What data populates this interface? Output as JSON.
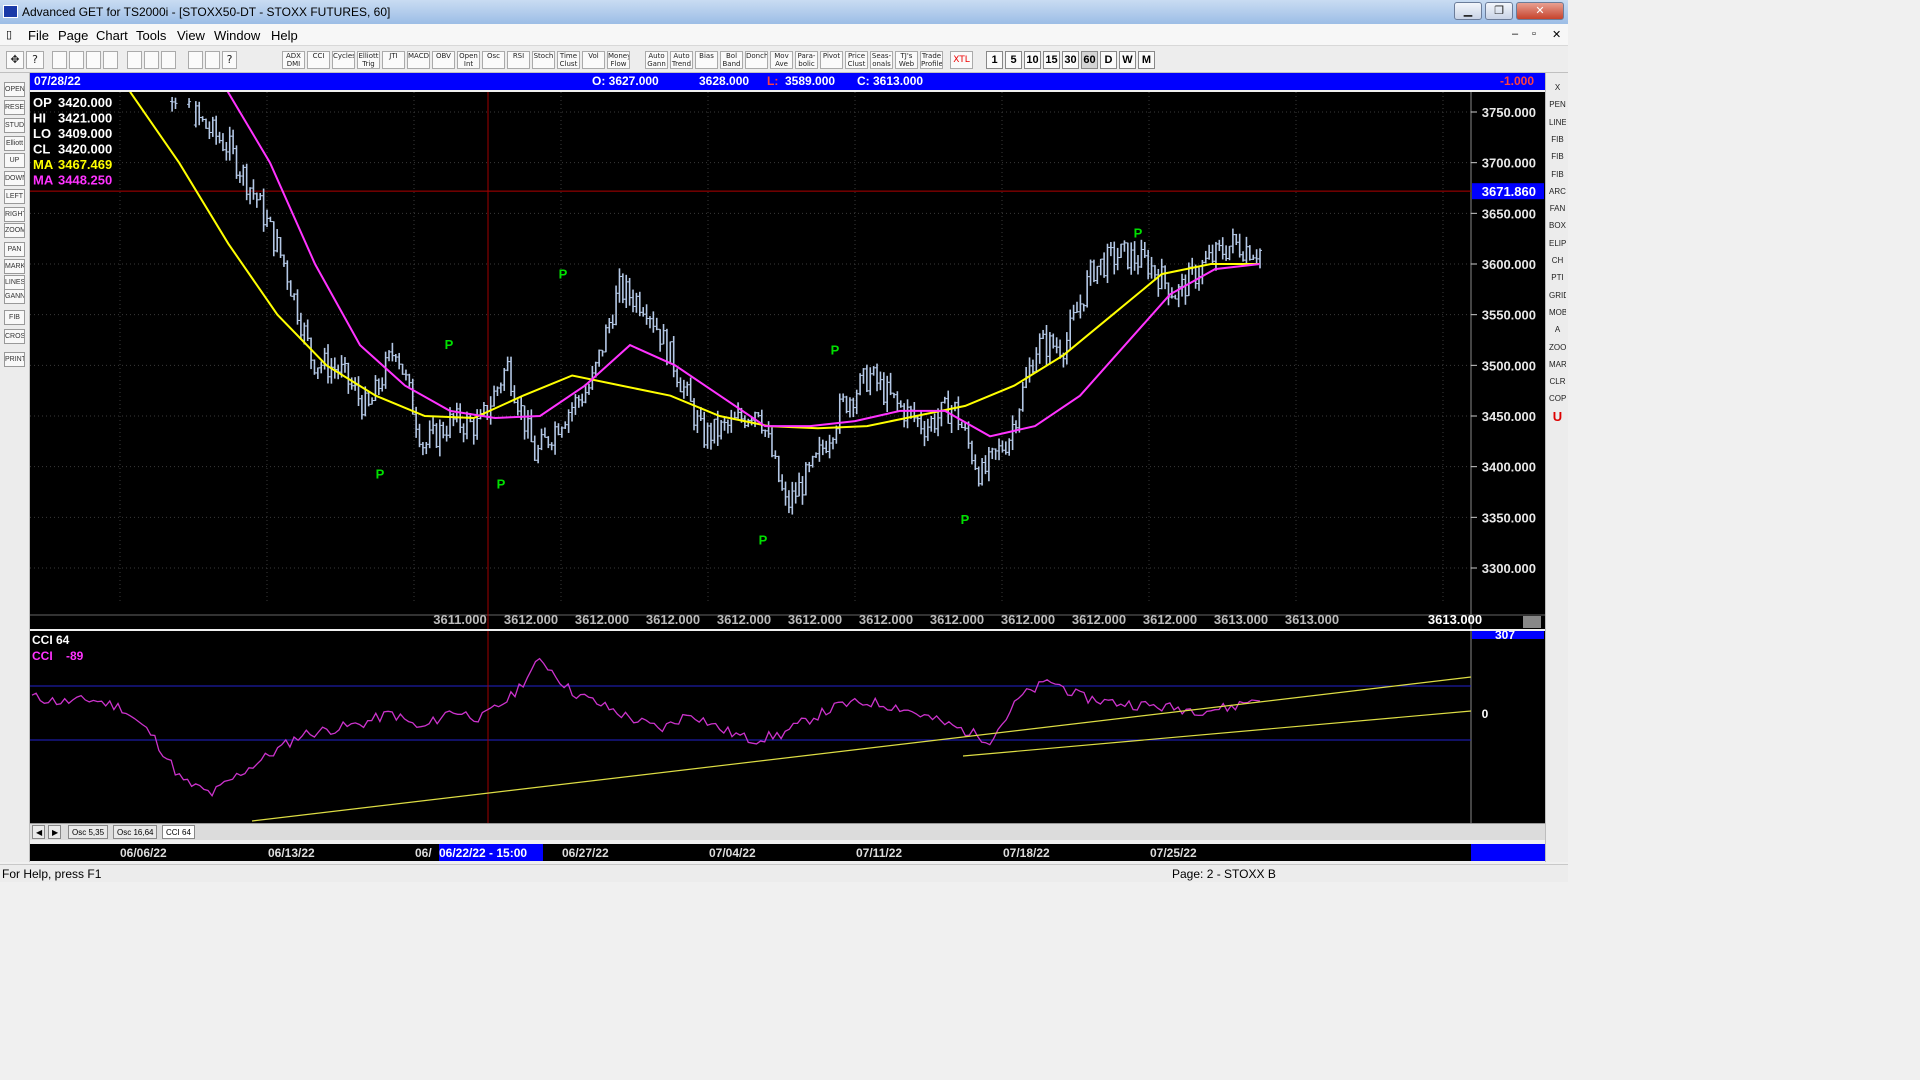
{
  "window": {
    "title": "Advanced GET for TS2000i - [STOXX50-DT - STOXX FUTURES, 60]",
    "min": "▁",
    "max": "❐",
    "close": "✕"
  },
  "mdi": {
    "min": "–",
    "restore": "▫",
    "close": "✕"
  },
  "menu": [
    "File",
    "Page",
    "Chart",
    "Tools",
    "View",
    "Window",
    "Help"
  ],
  "toolbar": {
    "study_buttons": [
      "ADX DMI",
      "CCI",
      "Cycles",
      "Elliott Trig",
      "JTI",
      "MACD",
      "OBV",
      "Open Int",
      "Osc",
      "RSI",
      "Stoch",
      "Time Clust",
      "Vol",
      "Money Flow",
      "Auto Gann",
      "Auto Trend",
      "Bias",
      "Bol Band",
      "Donch",
      "Mov Ave",
      "Para-bolic",
      "Pivot",
      "Price Clust",
      "Seas-onals",
      "TJ's Web",
      "Trade Profile",
      "XTL"
    ],
    "timeframes": [
      "1",
      "5",
      "10",
      "15",
      "30",
      "60",
      "D",
      "W",
      "M"
    ],
    "active_timeframe": "60"
  },
  "left_tools": [
    "OPEN",
    "RESET",
    "STUDY",
    "Elliott",
    "UP",
    "DOWN",
    "LEFT",
    "RIGHT",
    "ZOOM",
    "PAN",
    "MARK",
    "LINES",
    "GANN",
    "FIB",
    "CROSS",
    "PRINT"
  ],
  "right_tools": [
    "X",
    "PEN",
    "LINE",
    "FIB RET",
    "FIB EXT",
    "FIB TIME",
    "ARC",
    "FAN",
    "BOX",
    "ELIPS",
    "CH",
    "PTI",
    "GRID",
    "MOB",
    "A",
    "ZOOM",
    "MARK",
    "CLR",
    "COPY",
    "U"
  ],
  "info": {
    "date": "07/28/22",
    "open": "O: 3627.000",
    "high": "3628.000",
    "low_label": "L:",
    "low": "3589.000",
    "close": "C: 3613.000",
    "change": "-1.000"
  },
  "legend": [
    {
      "label": "OP",
      "value": "3420.000",
      "color": "#ffffff"
    },
    {
      "label": "HI",
      "value": "3421.000",
      "color": "#ffffff"
    },
    {
      "label": "LO",
      "value": "3409.000",
      "color": "#ffffff"
    },
    {
      "label": "CL",
      "value": "3420.000",
      "color": "#ffffff"
    },
    {
      "label": "MA",
      "value": "3467.469",
      "color": "#ffff00"
    },
    {
      "label": "MA",
      "value": "3448.250",
      "color": "#ff33ff"
    }
  ],
  "price_axis": {
    "ticks": [
      "3750.000",
      "3700.000",
      "3650.000",
      "3600.000",
      "3550.000",
      "3500.000",
      "3450.000",
      "3400.000",
      "3350.000",
      "3300.000"
    ],
    "marker": "3671.860"
  },
  "bottom_value_row": [
    "3611.000",
    "3612.000",
    "3612.000",
    "3612.000",
    "3612.000",
    "3612.000",
    "3612.000",
    "3612.000",
    "3612.000",
    "3612.000",
    "3612.000",
    "3613.000",
    "3613.000",
    "3613.000"
  ],
  "pivot_label": "P",
  "osc": {
    "title": "CCI 64",
    "sub_label": "CCI",
    "sub_value": "-89",
    "top_value": "307",
    "zero_value": "0"
  },
  "osc_tabs": [
    "Osc 5,35",
    "Osc 16,64",
    "CCI 64"
  ],
  "dates": [
    "06/06/22",
    "06/13/22",
    "06/",
    "06/22/22 - 15:00",
    "06/27/22",
    "07/04/22",
    "07/11/22",
    "07/18/22",
    "07/25/22"
  ],
  "status": {
    "help": "For Help, press F1",
    "page": "Page: 2 - STOXX B"
  },
  "colors": {
    "bar": "#b4c8e6",
    "ma_fast": "#ffff00",
    "ma_slow": "#ff33ff",
    "pivot": "#00e000",
    "cci": "#cc33cc",
    "trend": "#dddd44",
    "axis_bg": "#0000ff"
  },
  "chart_data": {
    "type": "ohlc",
    "timeframe": "60",
    "ylim": [
      3250,
      3775
    ],
    "ticks": [
      3750,
      3700,
      3650,
      3600,
      3550,
      3500,
      3450,
      3400,
      3350,
      3300
    ],
    "reference_line": 3671.86,
    "close_path": [
      {
        "date": "06/02/22",
        "close": 3790
      },
      {
        "date": "06/03/22",
        "close": 3770
      },
      {
        "date": "06/06/22",
        "close": 3740
      },
      {
        "date": "06/07/22",
        "close": 3715
      },
      {
        "date": "06/08/22",
        "close": 3665
      },
      {
        "date": "06/09/22",
        "close": 3600
      },
      {
        "date": "06/10/22",
        "close": 3505
      },
      {
        "date": "06/13/22",
        "close": 3495
      },
      {
        "date": "06/14/22",
        "close": 3455
      },
      {
        "date": "06/15/22",
        "close": 3520
      },
      {
        "date": "06/16/22",
        "close": 3420
      },
      {
        "date": "06/17/22",
        "close": 3445
      },
      {
        "date": "06/20/22",
        "close": 3440
      },
      {
        "date": "06/21/22",
        "close": 3500
      },
      {
        "date": "06/22/22",
        "close": 3410
      },
      {
        "date": "06/23/22",
        "close": 3450
      },
      {
        "date": "06/24/22",
        "close": 3480
      },
      {
        "date": "06/27/22",
        "close": 3575
      },
      {
        "date": "06/28/22",
        "close": 3560
      },
      {
        "date": "06/29/22",
        "close": 3500
      },
      {
        "date": "06/30/22",
        "close": 3430
      },
      {
        "date": "07/01/22",
        "close": 3440
      },
      {
        "date": "07/04/22",
        "close": 3460
      },
      {
        "date": "07/05/22",
        "close": 3360
      },
      {
        "date": "07/06/22",
        "close": 3400
      },
      {
        "date": "07/07/22",
        "close": 3460
      },
      {
        "date": "07/08/22",
        "close": 3490
      },
      {
        "date": "07/11/22",
        "close": 3460
      },
      {
        "date": "07/12/22",
        "close": 3440
      },
      {
        "date": "07/13/22",
        "close": 3460
      },
      {
        "date": "07/14/22",
        "close": 3390
      },
      {
        "date": "07/15/22",
        "close": 3430
      },
      {
        "date": "07/18/22",
        "close": 3520
      },
      {
        "date": "07/19/22",
        "close": 3520
      },
      {
        "date": "07/20/22",
        "close": 3595
      },
      {
        "date": "07/21/22",
        "close": 3610
      },
      {
        "date": "07/22/22",
        "close": 3600
      },
      {
        "date": "07/25/22",
        "close": 3570
      },
      {
        "date": "07/26/22",
        "close": 3600
      },
      {
        "date": "07/27/22",
        "close": 3620
      },
      {
        "date": "07/28/22",
        "close": 3613
      }
    ],
    "ma_fast": [
      3770,
      3700,
      3620,
      3550,
      3500,
      3470,
      3450,
      3448,
      3470,
      3490,
      3480,
      3470,
      3450,
      3440,
      3438,
      3440,
      3450,
      3460,
      3480,
      3510,
      3550,
      3590,
      3600,
      3600
    ],
    "ma_slow": [
      3800,
      3700,
      3600,
      3520,
      3480,
      3455,
      3448,
      3450,
      3480,
      3520,
      3500,
      3470,
      3440,
      3440,
      3445,
      3455,
      3455,
      3430,
      3440,
      3470,
      3520,
      3570,
      3595,
      3600
    ],
    "pivots": [
      {
        "type": "low",
        "date": "06/16/22",
        "price": 3410
      },
      {
        "type": "high",
        "date": "06/20/22",
        "price": 3510
      },
      {
        "type": "low",
        "date": "06/22/22",
        "price": 3400
      },
      {
        "type": "high",
        "date": "06/27/22",
        "price": 3580
      },
      {
        "type": "low",
        "date": "07/05/22",
        "price": 3345
      },
      {
        "type": "high",
        "date": "07/08/22",
        "price": 3505
      },
      {
        "type": "low",
        "date": "07/14/22",
        "price": 3365
      },
      {
        "type": "high",
        "date": "07/26/22",
        "price": 3620
      }
    ],
    "oscillator": {
      "name": "CCI 64",
      "current": -89,
      "max_label": 307,
      "values": [
        60,
        40,
        50,
        20,
        -80,
        -250,
        -300,
        -220,
        -150,
        -80,
        -60,
        -40,
        0,
        -60,
        10,
        -20,
        60,
        200,
        80,
        30,
        -20,
        -60,
        0,
        -60,
        -100,
        -80,
        -20,
        30,
        40,
        20,
        -20,
        -60,
        -100,
        60,
        120,
        60,
        40,
        30,
        20,
        10,
        20,
        60
      ]
    }
  }
}
